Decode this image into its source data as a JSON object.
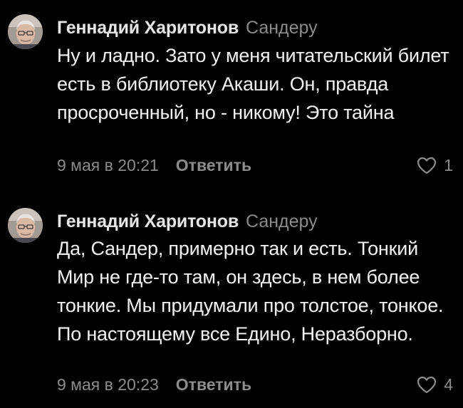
{
  "comments": [
    {
      "author": "Геннадий Харитонов",
      "reply_to": "Сандеру",
      "text": "Ну и ладно. Зато у меня читательский билет есть в библиотеку Акаши. Он, правда просроченный, но - никому! Это тайна",
      "time": "9 мая в 20:21",
      "reply_label": "Ответить",
      "likes": "1",
      "like_icon": "heart-outline-icon"
    },
    {
      "author": "Геннадий Харитонов",
      "reply_to": "Сандеру",
      "text": "Да, Сандер, примерно так и есть. Тонкий Мир не где-то там, он здесь, в нем более тонкие. Мы придумали про толстое, тонкое. По настоящему все Едино, Неразборно.",
      "time": "9 мая в 20:23",
      "reply_label": "Ответить",
      "likes": "4",
      "like_icon": "heart-outline-icon"
    }
  ],
  "colors": {
    "background": "#000000",
    "text": "#f2f2f2",
    "secondary": "#8c8c8c"
  }
}
